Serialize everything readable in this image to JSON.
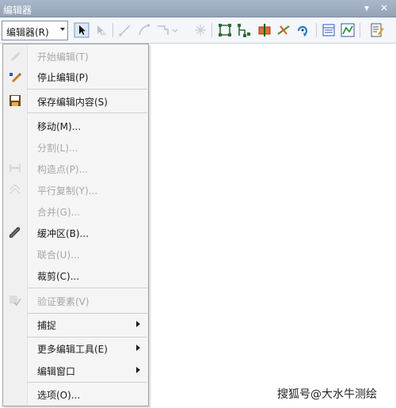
{
  "window": {
    "title": "编辑器",
    "collapse_glyph": "▾",
    "close_glyph": "✕"
  },
  "toolbar": {
    "editor_menu_label": "编辑器(R)",
    "icons": [
      "edit-tool-icon",
      "edit-annotation-icon",
      "straight-segment-icon",
      "end-point-arc-icon",
      "trace-icon",
      "point-icon",
      "edit-vertices-icon",
      "reshape-feature-icon",
      "cut-polygons-icon",
      "split-tool-icon",
      "rotate-tool-icon",
      "attributes-icon",
      "sketch-properties-icon",
      "create-features-icon"
    ]
  },
  "menu": {
    "items": [
      {
        "label": "开始编辑(T)",
        "disabled": true,
        "icon": "start-editing-icon"
      },
      {
        "label": "停止编辑(P)",
        "disabled": false,
        "icon": "stop-editing-icon"
      },
      {
        "label": "保存编辑内容(S)",
        "disabled": false,
        "icon": "save-edits-icon"
      },
      {
        "label": "移动(M)...",
        "disabled": false
      },
      {
        "label": "分割(L)...",
        "disabled": true
      },
      {
        "label": "构造点(P)...",
        "disabled": true,
        "icon": "construct-points-icon"
      },
      {
        "label": "平行复制(Y)...",
        "disabled": true,
        "icon": "copy-parallel-icon"
      },
      {
        "label": "合并(G)...",
        "disabled": true
      },
      {
        "label": "缓冲区(B)...",
        "disabled": false,
        "icon": "buffer-icon"
      },
      {
        "label": "联合(U)...",
        "disabled": true
      },
      {
        "label": "裁剪(C)...",
        "disabled": false
      },
      {
        "label": "验证要素(V)",
        "disabled": true,
        "icon": "validate-features-icon"
      },
      {
        "label": "捕捉",
        "disabled": false,
        "submenu": true
      },
      {
        "label": "更多编辑工具(E)",
        "disabled": false,
        "submenu": true
      },
      {
        "label": "编辑窗口",
        "disabled": false,
        "submenu": true
      },
      {
        "label": "选项(O)...",
        "disabled": false
      }
    ]
  },
  "watermark": "搜狐号@大水牛测绘"
}
